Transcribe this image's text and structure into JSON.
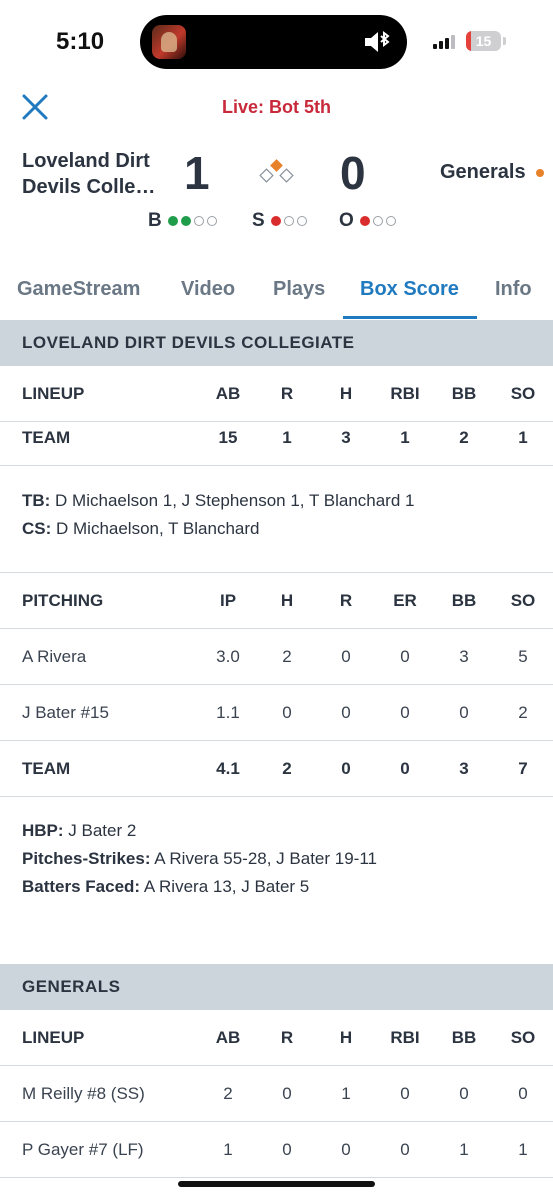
{
  "status_bar": {
    "time": "5:10",
    "battery": "15",
    "battery_level": 0.15
  },
  "header": {
    "close_icon": "close-icon",
    "live_status": "Live: Bot 5th",
    "away_team": "Loveland Dirt Devils Colle…",
    "away_score": "1",
    "home_team": "Generals",
    "home_score": "0",
    "count": {
      "balls_label": "B",
      "balls": 2,
      "strikes_label": "S",
      "strikes": 1,
      "outs_label": "O",
      "outs": 1
    },
    "bases_occupied": [
      "second"
    ],
    "colors": {
      "live": "#c8293b",
      "accent": "#1f7ac0",
      "base_occupied": "#e8822a",
      "ball": "#1f9d4a",
      "strike_out": "#d92d2d"
    }
  },
  "tabs": [
    {
      "label": "GameStream"
    },
    {
      "label": "Video"
    },
    {
      "label": "Plays"
    },
    {
      "label": "Box Score",
      "active": true
    },
    {
      "label": "Info"
    }
  ],
  "away": {
    "section_title": "LOVELAND DIRT DEVILS COLLEGIATE",
    "lineup_header": [
      "LINEUP",
      "AB",
      "R",
      "H",
      "RBI",
      "BB",
      "SO"
    ],
    "lineup_team_row": [
      "TEAM",
      "15",
      "1",
      "3",
      "1",
      "2",
      "1"
    ],
    "notes": [
      {
        "label": "TB:",
        "text": " D Michaelson 1, J Stephenson 1, T Blanchard 1"
      },
      {
        "label": "CS:",
        "text": " D Michaelson, T Blanchard"
      }
    ],
    "pitching_header": [
      "PITCHING",
      "IP",
      "H",
      "R",
      "ER",
      "BB",
      "SO"
    ],
    "pitchers": [
      [
        "A Rivera",
        "3.0",
        "2",
        "0",
        "0",
        "3",
        "5"
      ],
      [
        "J Bater #15",
        "1.1",
        "0",
        "0",
        "0",
        "0",
        "2"
      ]
    ],
    "pitching_team_row": [
      "TEAM",
      "4.1",
      "2",
      "0",
      "0",
      "3",
      "7"
    ],
    "pitching_notes": [
      {
        "label": "HBP:",
        "text": " J Bater 2"
      },
      {
        "label": "Pitches-Strikes:",
        "text": " A Rivera 55-28, J Bater 19-11"
      },
      {
        "label": "Batters Faced:",
        "text": " A Rivera 13, J Bater 5"
      }
    ]
  },
  "home": {
    "section_title": "GENERALS",
    "lineup_header": [
      "LINEUP",
      "AB",
      "R",
      "H",
      "RBI",
      "BB",
      "SO"
    ],
    "batters": [
      [
        "M Reilly #8 (SS)",
        "2",
        "0",
        "1",
        "0",
        "0",
        "0"
      ],
      [
        "P Gayer #7 (LF)",
        "1",
        "0",
        "0",
        "0",
        "1",
        "1"
      ]
    ]
  }
}
